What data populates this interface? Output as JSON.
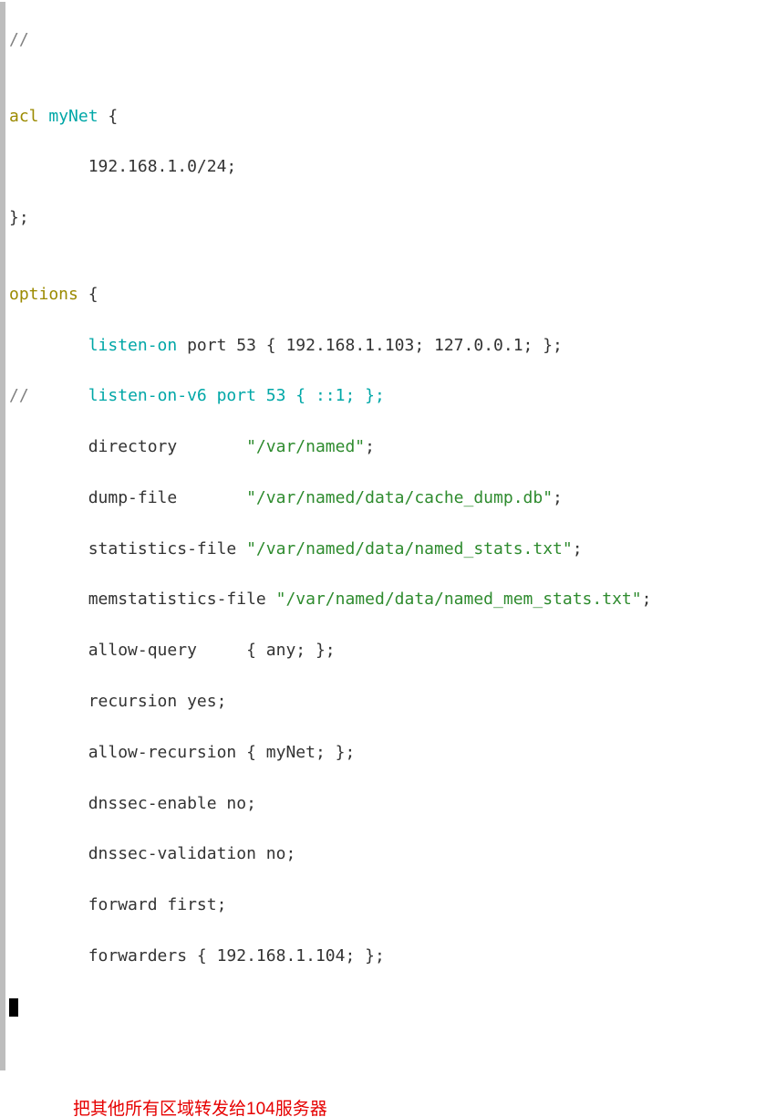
{
  "code": {
    "l1_comment": "//",
    "l2_blank": "",
    "l3_acl": "acl",
    "l3_name": " myNet ",
    "l3_brace": "{",
    "l4_indent": "        ",
    "l4_body": "192.168.1.0/24;",
    "l5_close": "};",
    "l6_blank": "",
    "l7_options": "options",
    "l7_brace": " {",
    "l8_indent": "        ",
    "l8_listen": "listen-on",
    "l8_rest": " port 53 { 192.168.1.103; 127.0.0.1; };",
    "l9_comment": "//",
    "l9_indent": "      ",
    "l9_listen6": "listen-on-v6 port 53 { ::1; };",
    "l10_indent": "        ",
    "l10_dir_lbl": "directory       ",
    "l10_dir_val": "\"/var/named\"",
    "l10_semi": ";",
    "l11_indent": "        ",
    "l11_df_lbl": "dump-file       ",
    "l11_df_val": "\"/var/named/data/cache_dump.db\"",
    "l11_semi": ";",
    "l12_indent": "        ",
    "l12_sf_lbl": "statistics-file ",
    "l12_sf_val": "\"/var/named/data/named_stats.txt\"",
    "l12_semi": ";",
    "l13_indent": "        ",
    "l13_ms_lbl": "memstatistics-file ",
    "l13_ms_val": "\"/var/named/data/named_mem_stats.txt\"",
    "l13_semi": ";",
    "l14_indent": "        ",
    "l14_body": "allow-query     { any; };",
    "l15_indent": "        ",
    "l15_body": "recursion yes;",
    "l16_indent": "        ",
    "l16_body": "allow-recursion { myNet; };",
    "l17_indent": "        ",
    "l17_body": "dnssec-enable no;",
    "l18_indent": "        ",
    "l18_body": "dnssec-validation no;",
    "l19_indent": "        ",
    "l19_body": "forward first;",
    "l20_indent": "        ",
    "l20_body": "forwarders { 192.168.1.104; };"
  },
  "caption": "把其他所有区域转发给104服务器"
}
